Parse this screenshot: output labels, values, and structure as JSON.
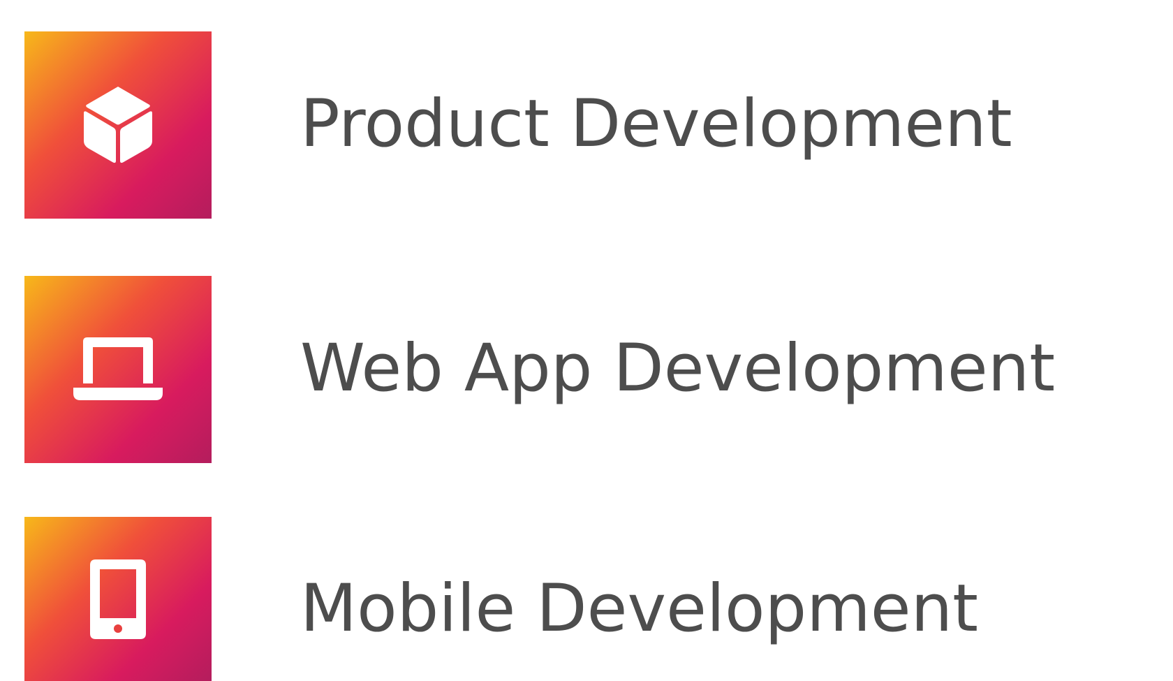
{
  "services": [
    {
      "label": "Product Development",
      "icon": "cube-icon"
    },
    {
      "label": "Web App Development",
      "icon": "laptop-icon"
    },
    {
      "label": "Mobile Development",
      "icon": "mobile-phone-icon"
    }
  ],
  "colors": {
    "gradient_start": "#f7b81a",
    "gradient_mid": "#f0503a",
    "gradient_end": "#c2185b",
    "text": "#4d4d4d",
    "icon": "#ffffff"
  }
}
